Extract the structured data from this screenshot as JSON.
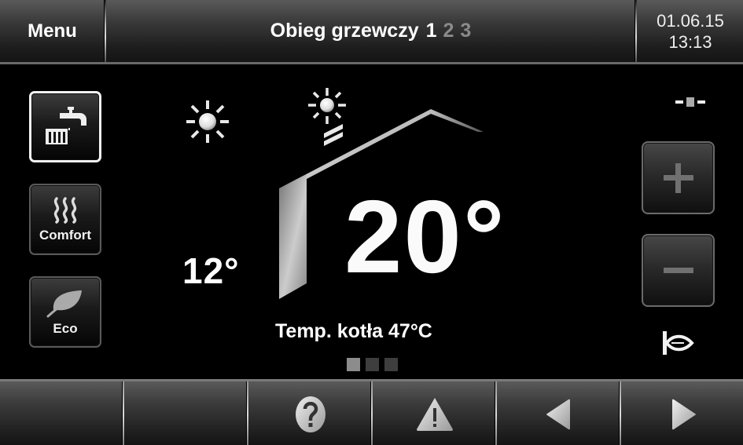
{
  "header": {
    "menu_label": "Menu",
    "title": "Obieg grzewczy",
    "circuits": [
      {
        "label": "1",
        "active": true
      },
      {
        "label": "2",
        "active": false
      },
      {
        "label": "3",
        "active": false
      }
    ],
    "date": "01.06.15",
    "time": "13:13"
  },
  "modes": [
    {
      "id": "dhw",
      "label": "",
      "icon": "tap-radiator-icon",
      "selected": true
    },
    {
      "id": "comfort",
      "label": "Comfort",
      "icon": "heat-waves-icon",
      "selected": false
    },
    {
      "id": "eco",
      "label": "Eco",
      "icon": "leaf-icon",
      "selected": false
    }
  ],
  "main": {
    "outdoor_temp": "12°",
    "room_temp": "20°",
    "boiler_temp": "Temp. kotła 47°C",
    "weather_icon": "sun-icon",
    "solar_icon": "solar-collector-icon",
    "pager": {
      "current": 1,
      "total": 3
    }
  },
  "right_panel": {
    "status_icon": "slider-indicator-icon",
    "plus_label": "+",
    "minus_label": "−",
    "bottom_icon": "holiday-fish-icon"
  },
  "footer": {
    "buttons": [
      {
        "id": "empty-1",
        "icon": ""
      },
      {
        "id": "empty-2",
        "icon": ""
      },
      {
        "id": "help",
        "icon": "help-icon"
      },
      {
        "id": "warning",
        "icon": "warning-icon"
      },
      {
        "id": "back",
        "icon": "arrow-left-icon"
      },
      {
        "id": "forward",
        "icon": "arrow-right-icon"
      }
    ]
  },
  "colors": {
    "background": "#000000",
    "text": "#ffffff",
    "inactive_text": "#8a8a8a",
    "pager_active": "#8c8c8c",
    "pager_inactive": "#3e3e3e"
  }
}
